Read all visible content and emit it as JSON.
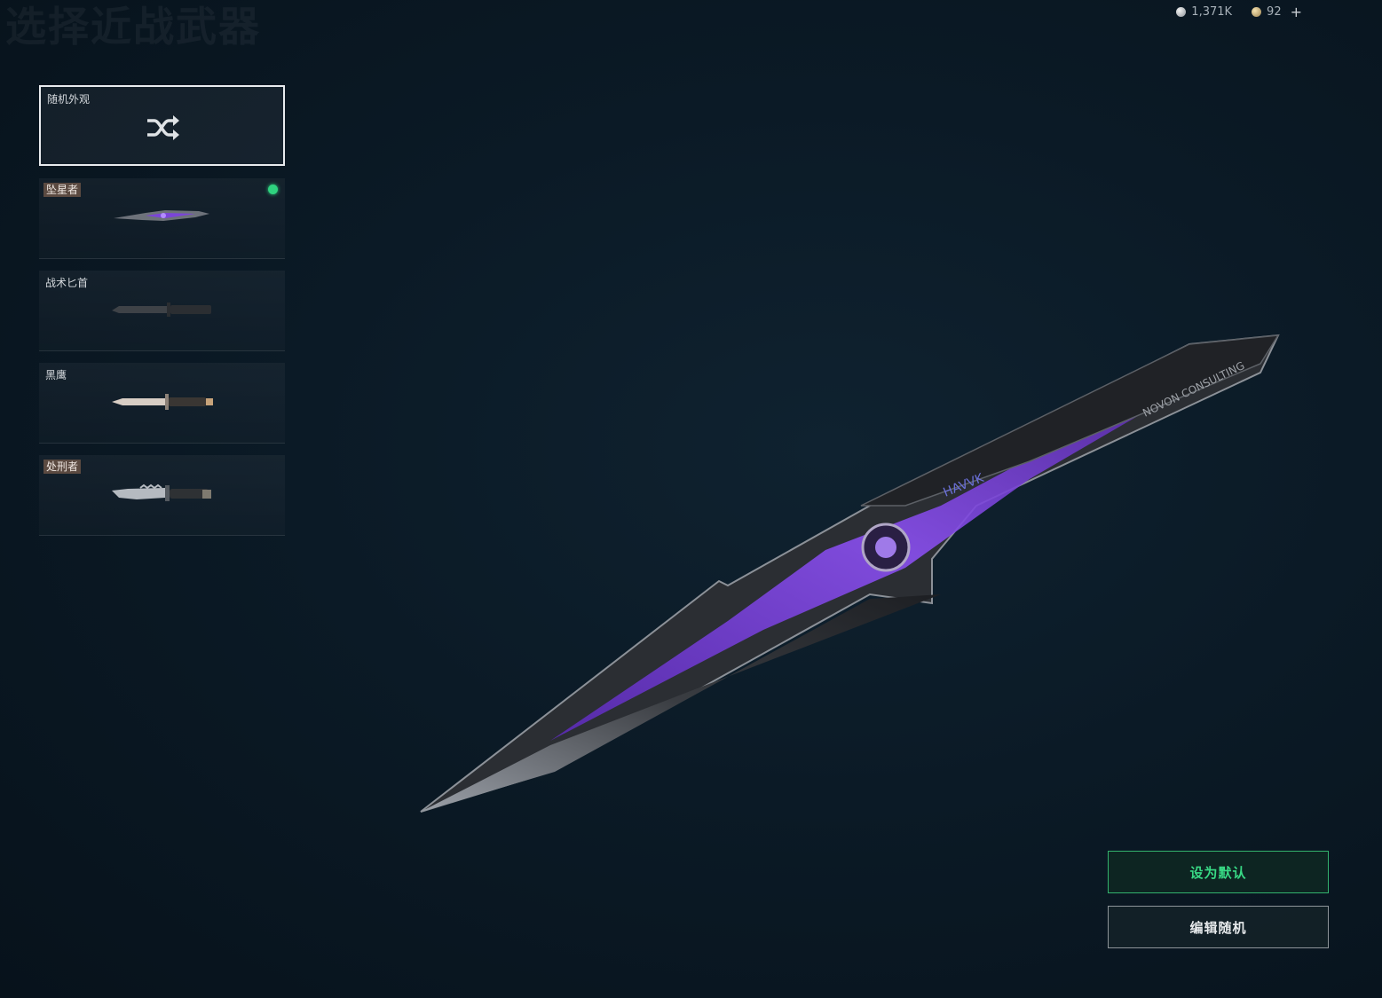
{
  "page": {
    "title": "选择近战武器"
  },
  "currency": {
    "silver": "1,371K",
    "gold": "92",
    "add": "+"
  },
  "list": {
    "items": [
      {
        "label": "随机外观",
        "selected": true,
        "icon": "shuffle-icon"
      },
      {
        "label": "坠星者",
        "equipped": true,
        "tag": true
      },
      {
        "label": "战术匕首",
        "tag": false
      },
      {
        "label": "黑鹰",
        "tag": false
      },
      {
        "label": "处刑者",
        "tag": true
      }
    ]
  },
  "weapon": {
    "engraving_brand": "HAVVK",
    "engraving_text": "NOVON CONSULTING"
  },
  "buttons": {
    "set_default": "设为默认",
    "edit_random": "编辑随机"
  },
  "colors": {
    "accent_green": "#2fd27f",
    "blade_purple": "#7a3fe0",
    "background": "#0b1a26"
  }
}
